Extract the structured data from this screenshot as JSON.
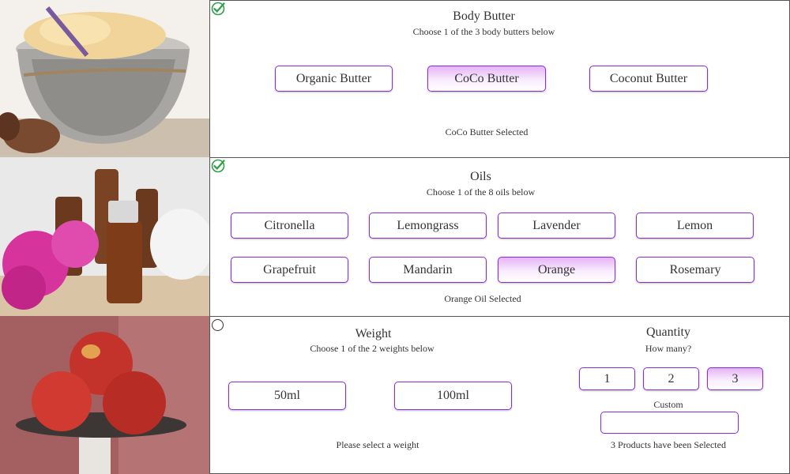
{
  "colors": {
    "accent": "#8a2be2",
    "check": "#2e9e48",
    "selected_gradient_top": "#e6b3f7"
  },
  "butter": {
    "title": "Body Butter",
    "subtitle": "Choose 1 of the 3 body butters below",
    "options": [
      "Organic Butter",
      "CoCo Butter",
      "Coconut Butter"
    ],
    "selected": "CoCo Butter",
    "status": "CoCo Butter Selected",
    "complete_icon": "check-circle-icon"
  },
  "oils": {
    "title": "Oils",
    "subtitle": "Choose 1 of the 8 oils below",
    "options": [
      "Citronella",
      "Lemongrass",
      "Lavender",
      "Lemon",
      "Grapefruit",
      "Mandarin",
      "Orange",
      "Rosemary"
    ],
    "selected": "Orange",
    "status": "Orange Oil Selected",
    "complete_icon": "check-circle-icon"
  },
  "weight": {
    "title": "Weight",
    "subtitle": "Choose 1 of the 2 weights below",
    "options": [
      "50ml",
      "100ml"
    ],
    "status": "Please select a weight",
    "incomplete_icon": "radio-circle-icon"
  },
  "quantity": {
    "title": "Quantity",
    "subtitle": "How many?",
    "options": [
      "1",
      "2",
      "3"
    ],
    "selected": "3",
    "custom_label": "Custom",
    "custom_value": "",
    "status": "3 Products have been Selected"
  }
}
